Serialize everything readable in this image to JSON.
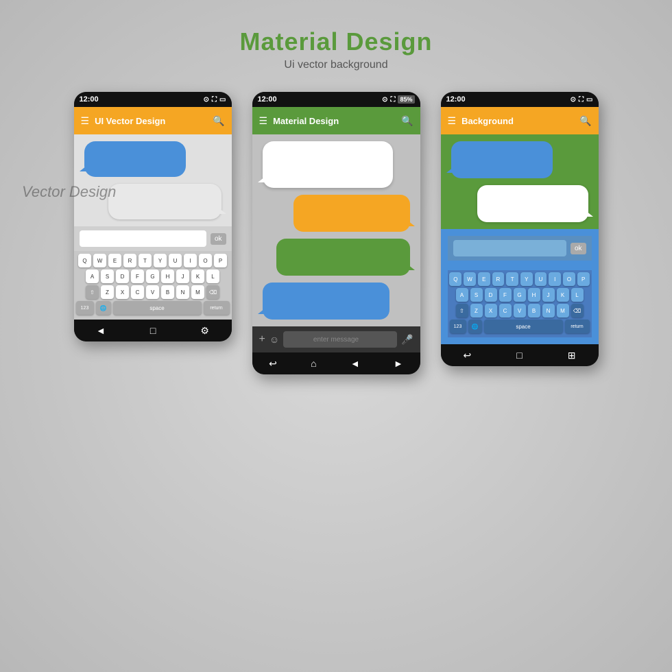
{
  "header": {
    "title": "Material Design",
    "subtitle": "Ui vector background"
  },
  "phone1": {
    "status_time": "12:00",
    "app_bar_title": "UI Vector Design",
    "input_placeholder": "",
    "ok_label": "ok",
    "nav": [
      "◄",
      "□",
      "⚙"
    ]
  },
  "phone2": {
    "status_time": "12:00",
    "status_battery": "85%",
    "app_bar_title": "Material Design",
    "enter_message": "enter message",
    "nav": [
      "↩",
      "⌂",
      "◄",
      "►"
    ]
  },
  "phone3": {
    "status_time": "12:00",
    "app_bar_title": "Background",
    "ok_label": "ok",
    "nav": [
      "↩",
      "□",
      "⊞"
    ]
  },
  "keyboard": {
    "row1": [
      "Q",
      "W",
      "E",
      "R",
      "T",
      "Y",
      "U",
      "I",
      "O",
      "P"
    ],
    "row2": [
      "A",
      "S",
      "D",
      "F",
      "G",
      "H",
      "J",
      "K",
      "L"
    ],
    "row3": [
      "Z",
      "X",
      "C",
      "V",
      "B",
      "N",
      "M"
    ],
    "bottom": [
      "123",
      "🌐",
      "space",
      "return"
    ]
  }
}
